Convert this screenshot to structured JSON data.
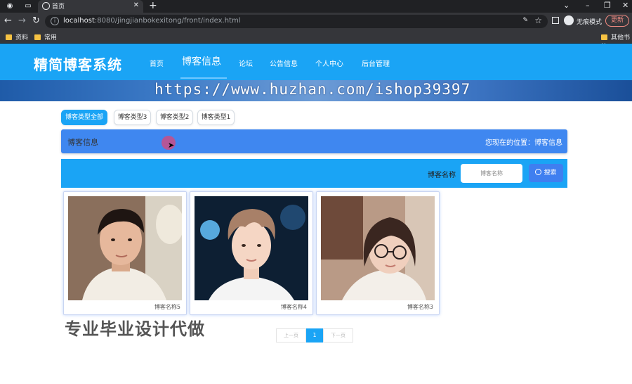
{
  "browser": {
    "tab_title": "首页",
    "url_host": "localhost",
    "url_path": ":8080/jingjianbokexitong/front/index.html",
    "incognito_label": "无痕模式",
    "update_label": "更新",
    "bookmarks": [
      "资料",
      "常用"
    ],
    "other_bookmarks": "其他书签"
  },
  "site": {
    "logo": "精简博客系统",
    "nav": [
      "首页",
      "博客信息",
      "论坛",
      "公告信息",
      "个人中心",
      "后台管理"
    ],
    "active_nav_index": 1
  },
  "watermark": "https://www.huzhan.com/ishop39397",
  "filters": [
    "博客类型全部",
    "博客类型3",
    "博客类型2",
    "博客类型1"
  ],
  "crumb": {
    "title": "博客信息",
    "location": "您现在的位置：博客信息"
  },
  "search": {
    "label": "博客名称",
    "placeholder": "博客名称",
    "button_label": "搜索"
  },
  "cards": [
    {
      "caption": "博客名称5",
      "photo": "young-man-selfie"
    },
    {
      "caption": "博客名称4",
      "photo": "young-man-portrait"
    },
    {
      "caption": "博客名称3",
      "photo": "young-woman-glasses"
    }
  ],
  "promo_text": "专业毕业设计代做",
  "pagination": {
    "prev": "上一页",
    "current": "1",
    "next": "下一页"
  },
  "colors": {
    "header": "#1aa4f5",
    "crumb_bar": "#3f87f0",
    "search_button": "#3f7ff0"
  }
}
